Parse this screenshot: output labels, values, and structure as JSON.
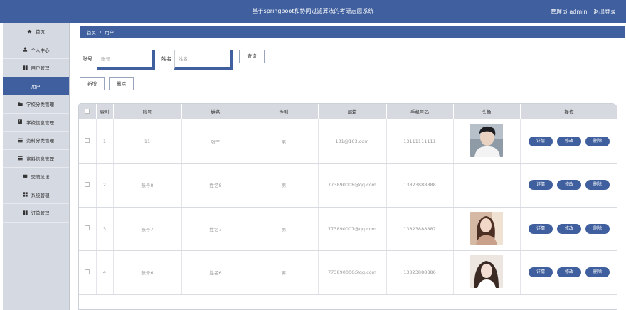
{
  "header": {
    "title": "基于springboot和协同过滤算法的考研志愿系统",
    "user_label": "管理员 admin",
    "logout": "退出登录"
  },
  "sidebar": {
    "items": [
      {
        "label": "首页",
        "icon": "home-icon"
      },
      {
        "label": "个人中心",
        "icon": "user-icon"
      },
      {
        "label": "用户管理",
        "icon": "grid-icon"
      },
      {
        "label": "用户",
        "icon": "",
        "active": true
      },
      {
        "label": "学校分类管理",
        "icon": "folder-icon"
      },
      {
        "label": "学校信息管理",
        "icon": "building-icon"
      },
      {
        "label": "资料分类管理",
        "icon": "list-icon"
      },
      {
        "label": "资料信息管理",
        "icon": "list-icon"
      },
      {
        "label": "交流论坛",
        "icon": "chat-icon"
      },
      {
        "label": "系统管理",
        "icon": "grid-icon"
      },
      {
        "label": "订单管理",
        "icon": "grid-icon"
      }
    ]
  },
  "breadcrumb": {
    "home": "首页",
    "sep": "/",
    "current": "用户"
  },
  "search": {
    "account_label": "账号",
    "account_placeholder": "账号",
    "name_label": "姓名",
    "name_placeholder": "姓名",
    "query_button": "查询"
  },
  "actions": {
    "add": "新增",
    "delete": "删除"
  },
  "table": {
    "columns": [
      "",
      "索引",
      "账号",
      "姓名",
      "性别",
      "邮箱",
      "手机号码",
      "头像",
      "操作"
    ],
    "row_buttons": {
      "detail": "详情",
      "edit": "修改",
      "delete": "删除"
    },
    "rows": [
      {
        "index": "1",
        "account": "11",
        "name": "张三",
        "gender": "男",
        "email": "131@163.com",
        "phone": "13111111111",
        "avatar": "male"
      },
      {
        "index": "2",
        "account": "账号8",
        "name": "姓名8",
        "gender": "男",
        "email": "773890008@qq.com",
        "phone": "13823888888",
        "avatar": "none"
      },
      {
        "index": "3",
        "account": "账号7",
        "name": "姓名7",
        "gender": "男",
        "email": "773890007@qq.com",
        "phone": "13823888887",
        "avatar": "female"
      },
      {
        "index": "4",
        "account": "账号6",
        "name": "姓名6",
        "gender": "男",
        "email": "773890006@qq.com",
        "phone": "13823888886",
        "avatar": "female2"
      }
    ]
  }
}
